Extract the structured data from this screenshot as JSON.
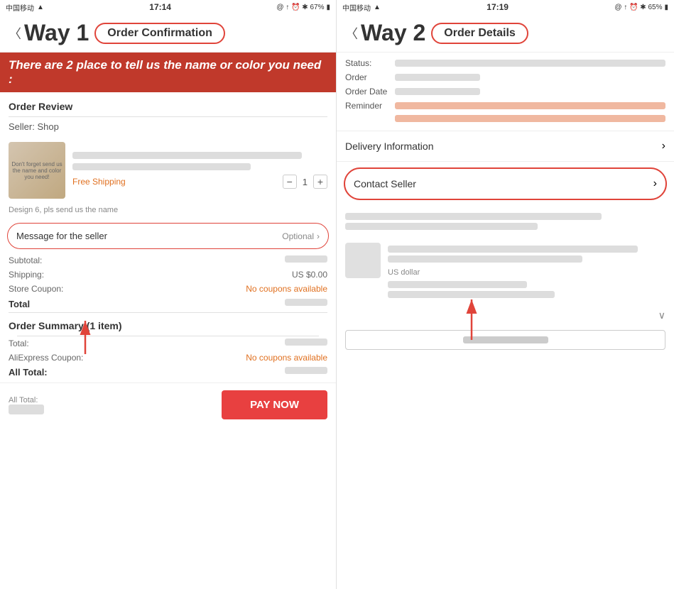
{
  "left": {
    "status_bar": {
      "carrier": "中国移动",
      "wifi": "📶",
      "time": "17:14",
      "icons": "@ ↑ ⏰ ✱ 67%",
      "battery": "🔋"
    },
    "way_label": "Way 1",
    "screen_title": "Order Confirmation",
    "section_title": "Order Review",
    "seller_label": "Seller:  Shop",
    "free_shipping": "Free Shipping",
    "quantity": "1",
    "design_note": "Design 6, pls send us the name",
    "message_seller_label": "Message for the seller",
    "message_seller_optional": "Optional",
    "subtotal_label": "Subtotal:",
    "shipping_label": "Shipping:",
    "shipping_value": "US $0.00",
    "store_coupon_label": "Store Coupon:",
    "store_coupon_value": "No coupons available",
    "total_label": "Total",
    "order_summary_title": "Order Summary (1 item)",
    "total_label2": "Total:",
    "aliexpress_coupon_label": "AliExpress Coupon:",
    "aliexpress_coupon_value": "No coupons available",
    "all_total_label": "All Total:",
    "all_total_label2": "All Total:",
    "pay_now": "PAY NOW"
  },
  "right": {
    "status_bar": {
      "carrier": "中国移动",
      "wifi": "📶",
      "time": "17:19",
      "icons": "@ ↑ ⏰ ✱ 65%",
      "battery": "🔋"
    },
    "way_label": "Way 2",
    "screen_title": "Order Details",
    "status_label": "Status:",
    "order_label": "Order",
    "order_date_label": "Order Date",
    "reminder_label": "Reminder",
    "delivery_label": "Delivery Information",
    "contact_seller_label": "Contact Seller",
    "us_dollar": "US dollar"
  },
  "banner": {
    "text": "There are 2 place to tell us the name or color you need :"
  }
}
